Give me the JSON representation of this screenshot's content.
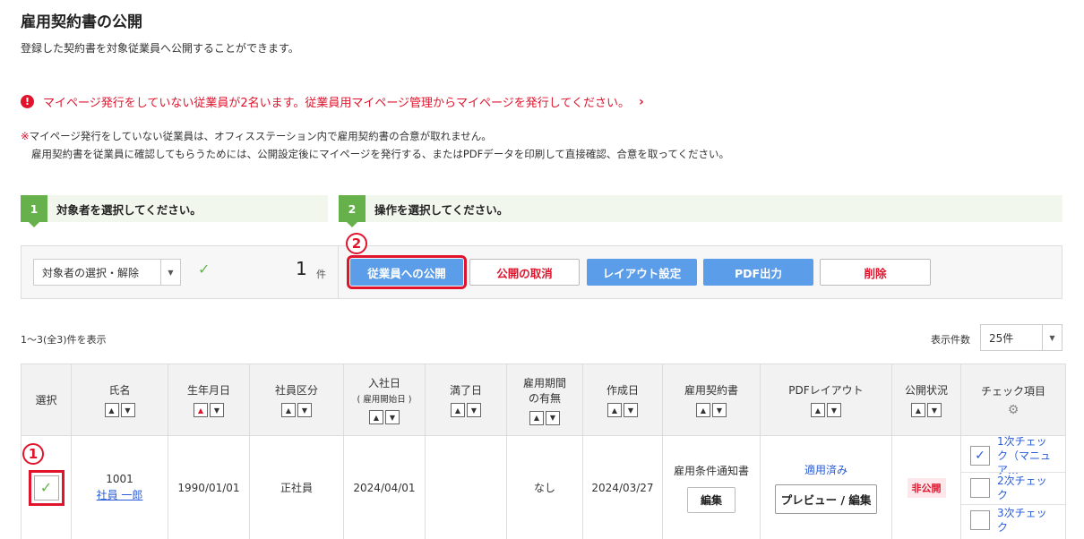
{
  "page": {
    "title": "雇用契約書の公開",
    "description": "登録した契約書を対象従業員へ公開することができます。"
  },
  "alert": {
    "icon": "exclamation-icon",
    "text": "マイページ発行をしていない従業員が2名います。従業員用マイページ管理からマイページを発行してください。",
    "chevron": "›"
  },
  "note": {
    "mark": "※",
    "line1": "マイページ発行をしていない従業員は、オフィスステーション内で雇用契約書の合意が取れません。",
    "line2": "雇用契約書を従業員に確認してもらうためには、公開設定後にマイページを発行する、またはPDFデータを印刷して直接確認、合意を取ってください。"
  },
  "steps": [
    {
      "num": "1",
      "label": "対象者を選択してください。"
    },
    {
      "num": "2",
      "label": "操作を選択してください。"
    }
  ],
  "selection": {
    "select_label": "対象者の選択・解除",
    "check_icon": "✓",
    "count": "1",
    "count_unit": "件"
  },
  "actions": {
    "publish": "従業員への公開",
    "unpublish": "公開の取消",
    "layout": "レイアウト設定",
    "pdf": "PDF出力",
    "delete": "削除"
  },
  "annotations": {
    "one": "1",
    "two": "2"
  },
  "list": {
    "range_text": "1～3(全3)件を表示",
    "per_page_label": "表示件数",
    "per_page_value": "25件"
  },
  "table": {
    "headers": {
      "select": "選択",
      "name": "氏名",
      "birth": "生年月日",
      "type": "社員区分",
      "join": "入社日",
      "join_sub": "( 雇用開始日 )",
      "expire": "満了日",
      "period_l1": "雇用期間",
      "period_l2": "の有無",
      "created": "作成日",
      "contract": "雇用契約書",
      "pdf_layout": "PDFレイアウト",
      "status": "公開状況",
      "checks": "チェック項目"
    },
    "row": {
      "emp_no": "1001",
      "emp_name": "社員 一郎",
      "birth": "1990/01/01",
      "type": "正社員",
      "join": "2024/04/01",
      "expire": "",
      "period": "なし",
      "created": "2024/03/27",
      "contract_name": "雇用条件通知書",
      "edit_label": "編集",
      "layout_status": "適用済み",
      "preview_label": "プレビュー / 編集",
      "status": "非公開",
      "checks": [
        {
          "label": "1次チェック（マニュア…",
          "checked": true
        },
        {
          "label": "2次チェック",
          "checked": false
        },
        {
          "label": "3次チェック",
          "checked": false
        }
      ]
    }
  }
}
